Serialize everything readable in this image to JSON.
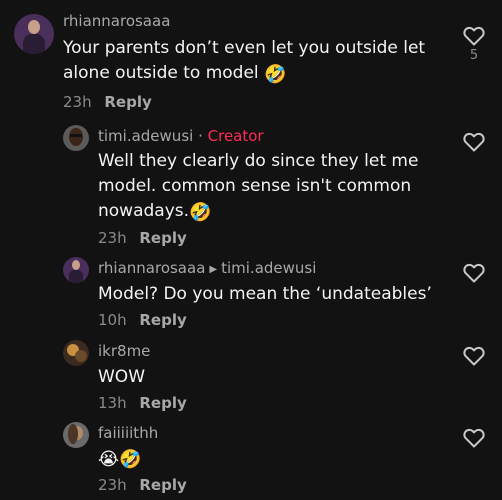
{
  "comments": [
    {
      "username": "rhiannarosaaa",
      "text_lines": [
        "Your parents don’t even let you outside let",
        "alone outside to model"
      ],
      "emoji": "🤣",
      "time": "23h",
      "reply_label": "Reply",
      "likes": "5"
    },
    {
      "username": "timi.adewusi",
      "separator": "·",
      "badge": "Creator",
      "text_lines": [
        "Well they clearly do since they let me",
        "model. common sense isn't common",
        "nowadays."
      ],
      "emoji": "🤣",
      "time": "23h",
      "reply_label": "Reply"
    },
    {
      "username": "rhiannarosaaa",
      "reply_arrow": "▶",
      "reply_to": "timi.adewusi",
      "text_lines": [
        "Model? Do you mean the ‘undateables’"
      ],
      "time": "10h",
      "reply_label": "Reply"
    },
    {
      "username": "ikr8me",
      "text_lines": [
        "WOW"
      ],
      "time": "13h",
      "reply_label": "Reply"
    },
    {
      "username": "faiiiiithh",
      "emoji_line": "😭🤣",
      "time": "23h",
      "reply_label": "Reply"
    }
  ],
  "colors": {
    "background": "#121212",
    "creator_badge": "#fe2c55",
    "secondary_text": "#a8a8a8"
  },
  "icons": [
    "heart-outline-icon"
  ]
}
